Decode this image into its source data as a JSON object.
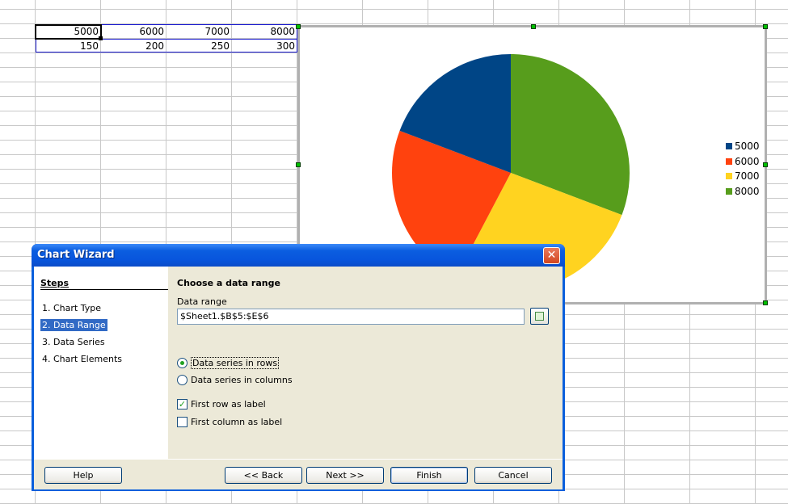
{
  "sheet": {
    "row1": [
      "5000",
      "6000",
      "7000",
      "8000"
    ],
    "row2": [
      "150",
      "200",
      "250",
      "300"
    ]
  },
  "chart": {
    "legend": [
      {
        "label": "5000",
        "color": "#004586"
      },
      {
        "label": "6000",
        "color": "#ff420e"
      },
      {
        "label": "7000",
        "color": "#ffd320"
      },
      {
        "label": "8000",
        "color": "#579d1c"
      }
    ]
  },
  "chart_data": {
    "type": "pie",
    "categories": [
      "5000",
      "6000",
      "7000",
      "8000"
    ],
    "values": [
      5000,
      6000,
      7000,
      8000
    ]
  },
  "dialog": {
    "title": "Chart Wizard",
    "close_glyph": "✕",
    "steps_heading": "Steps",
    "steps": [
      "1. Chart Type",
      "2. Data Range",
      "3. Data Series",
      "4. Chart Elements"
    ],
    "active_step": 1,
    "heading": "Choose a data range",
    "range_label": "Data range",
    "range_value": "$Sheet1.$B$5:$E$6",
    "rows_label": "Data series in rows",
    "columns_label": "Data series in columns",
    "series_in": "rows",
    "first_row_label": "First row as label",
    "first_row_checked": true,
    "first_col_label": "First column as label",
    "first_col_checked": false,
    "buttons": {
      "help": "Help",
      "back": "<< Back",
      "next": "Next >>",
      "finish": "Finish",
      "cancel": "Cancel"
    }
  }
}
